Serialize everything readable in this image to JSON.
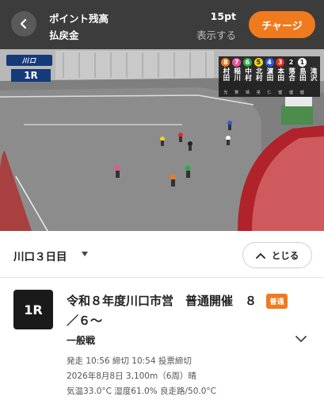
{
  "header": {
    "points_label": "ポイント残高",
    "points_value": "15pt",
    "refund_label": "払戻金",
    "refund_link": "表示する",
    "charge_button": "チャージ"
  },
  "video": {
    "logo_text": "川口",
    "race_no": "1R",
    "riders": [
      {
        "num": "8",
        "name": "村田",
        "sub": "光",
        "color": "#f07a1e",
        "text": "#fff"
      },
      {
        "num": "7",
        "name": "稲川",
        "sub": "賢",
        "color": "#e8539a",
        "text": "#fff"
      },
      {
        "num": "6",
        "name": "中村",
        "sub": "晴",
        "color": "#2eaa4a",
        "text": "#fff"
      },
      {
        "num": "5",
        "name": "北村",
        "sub": "晃",
        "color": "#f1d31d",
        "text": "#222"
      },
      {
        "num": "4",
        "name": "濵田",
        "sub": "仁",
        "color": "#2a5bd7",
        "text": "#fff"
      },
      {
        "num": "3",
        "name": "本田",
        "sub": "健",
        "color": "#e02a2a",
        "text": "#fff"
      },
      {
        "num": "2",
        "name": "落合",
        "sub": "健",
        "color": "#222222",
        "text": "#fff"
      },
      {
        "num": "1",
        "name": "島田",
        "sub": "健",
        "color": "#ffffff",
        "text": "#222"
      },
      {
        "num": "",
        "name": "滝沢",
        "sub": "",
        "color": "",
        "text": "#fff"
      }
    ]
  },
  "day_selector": {
    "label": "川口３日目",
    "close_button": "とじる"
  },
  "race": {
    "badge": "1R",
    "title": "令和８年度川口市営　普通開催　８／６～",
    "grade": "普通",
    "type": "一般戦",
    "times": "発走 10:56  締切 10:54   投票締切",
    "date_line": "2026年8月8日  3,100m（6周）晴",
    "weather_line": "気温33.0°C  湿度61.0%  良走路/50.0°C"
  },
  "colors": {
    "accent": "#f07a1e",
    "topbar": "#3c3c3c"
  }
}
